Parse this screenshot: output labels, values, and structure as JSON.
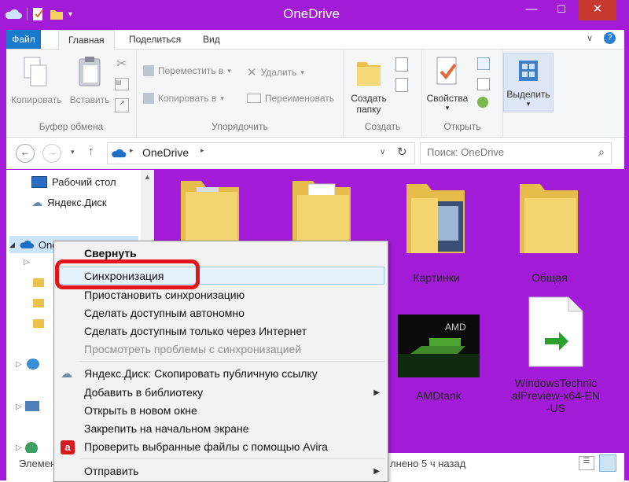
{
  "window": {
    "title": "OneDrive",
    "minimize": "—",
    "maximize": "☐",
    "close": "✕"
  },
  "tabs": {
    "file": "Файл",
    "home": "Главная",
    "share": "Поделиться",
    "view": "Вид"
  },
  "ribbon": {
    "clipboard": {
      "copy": "Копировать",
      "paste": "Вставить",
      "label": "Буфер обмена"
    },
    "organize": {
      "move": "Переместить в",
      "copy_to": "Копировать в",
      "delete": "Удалить",
      "rename": "Переименовать",
      "label": "Упорядочить"
    },
    "new": {
      "new_folder_1": "Создать",
      "new_folder_2": "папку",
      "label": "Создать"
    },
    "open": {
      "properties": "Свойства",
      "label": "Открыть"
    },
    "select": {
      "select": "Выделить"
    }
  },
  "address": {
    "location": "OneDrive",
    "search_placeholder": "Поиск: OneDrive"
  },
  "nav": {
    "desktop": "Рабочий стол",
    "yadisk": "Яндекс.Диск",
    "onedrive": "OneDrive"
  },
  "files": [
    {
      "name": "Картинки"
    },
    {
      "name": "Общая"
    },
    {
      "name": "AMDtank"
    },
    {
      "name": "WindowsTechnic alPreview-x64-EN -US",
      "line1": "WindowsTechnic",
      "line2": "alPreview-x64-EN",
      "line3": "-US"
    }
  ],
  "status": {
    "left": "Элемен",
    "right": "лнено 5 ч назад"
  },
  "context_menu": {
    "collapse": "Свернуть",
    "sync": "Синхронизация",
    "pause": "Приостановить синхронизацию",
    "offline": "Сделать доступным автономно",
    "online_only": "Сделать доступным только через Интернет",
    "view_problems": "Просмотреть проблемы с синхронизацией",
    "yadisk_link": "Яндекс.Диск: Скопировать публичную ссылку",
    "add_library": "Добавить в библиотеку",
    "open_new_window": "Открыть в новом окне",
    "pin_start": "Закрепить на начальном экране",
    "avira": "Проверить выбранные файлы с помощью Avira",
    "send_to": "Отправить"
  },
  "colors": {
    "accent": "#a21bd6",
    "file_tab": "#1979ca",
    "highlight_ring": "#e4151a"
  }
}
